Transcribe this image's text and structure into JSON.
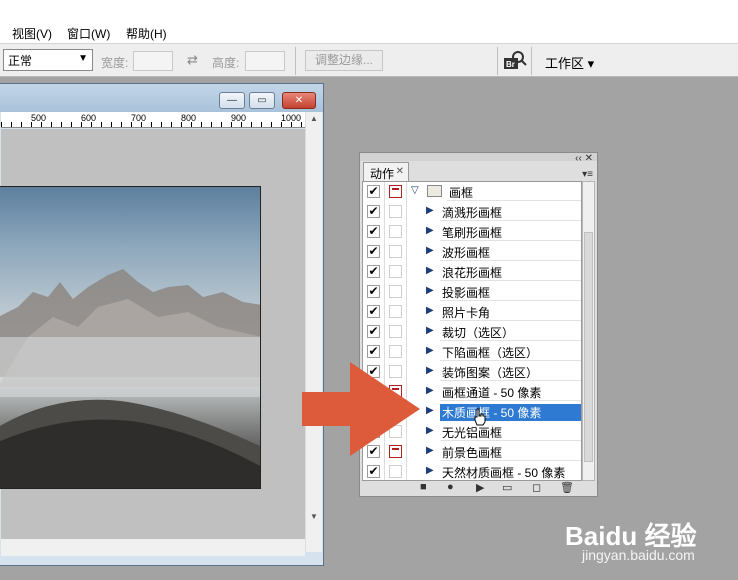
{
  "menu": {
    "items": [
      "视图(V)",
      "窗口(W)",
      "帮助(H)"
    ]
  },
  "options": {
    "style_value": "正常",
    "width_label": "宽度:",
    "height_label": "高度:",
    "adjust_edge_label": "调整边缘...",
    "bridge_icon": "Br",
    "workspace_label": "工作区 ▾"
  },
  "document": {
    "ruler_ticks": [
      "500",
      "600",
      "700",
      "800",
      "900",
      "1000"
    ],
    "buttons": {
      "minimize": "—",
      "restore": "▭",
      "close": "✕"
    }
  },
  "actions_panel": {
    "tab_label": "动作",
    "set_name": "画框",
    "actions": [
      {
        "label": "滴溅形画框",
        "checked": true,
        "dialog": false
      },
      {
        "label": "笔刷形画框",
        "checked": true,
        "dialog": false
      },
      {
        "label": "波形画框",
        "checked": true,
        "dialog": false
      },
      {
        "label": "浪花形画框",
        "checked": true,
        "dialog": false
      },
      {
        "label": "投影画框",
        "checked": true,
        "dialog": false
      },
      {
        "label": "照片卡角",
        "checked": true,
        "dialog": false
      },
      {
        "label": "裁切（选区）",
        "checked": true,
        "dialog": false
      },
      {
        "label": "下陷画框（选区）",
        "checked": true,
        "dialog": false
      },
      {
        "label": "装饰图案（选区）",
        "checked": true,
        "dialog": false
      },
      {
        "label": "画框通道 - 50 像素",
        "checked": true,
        "dialog": true
      },
      {
        "label": "木质画框 - 50 像素",
        "checked": true,
        "dialog": false,
        "selected": true
      },
      {
        "label": "无光铝画框",
        "checked": true,
        "dialog": false
      },
      {
        "label": "前景色画框",
        "checked": true,
        "dialog": true
      },
      {
        "label": "天然材质画框 - 50 像素",
        "checked": true,
        "dialog": false
      }
    ],
    "toolbar_icons": [
      "stop-icon",
      "record-icon",
      "play-icon",
      "folder-icon",
      "new-action-icon",
      "trash-icon"
    ]
  },
  "annotation": {
    "arrow_color": "#dd5a3a"
  },
  "watermark": {
    "brand": "Baidu 经验",
    "url": "jingyan.baidu.com"
  }
}
